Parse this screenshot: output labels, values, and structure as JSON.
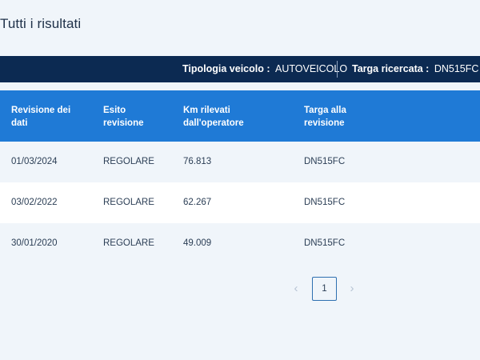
{
  "page_title": "Tutti i risultati",
  "info_bar": {
    "vehicle_type_label": "Tipologia veicolo :",
    "vehicle_type_value": "AUTOVEICOLO",
    "plate_label": "Targa ricercata :",
    "plate_value": "DN515FC"
  },
  "table": {
    "columns": [
      {
        "line1": "Revisione dei",
        "line2": "dati"
      },
      {
        "line1": "Esito",
        "line2": "revisione"
      },
      {
        "line1": "Km rilevati",
        "line2": "dall'operatore"
      },
      {
        "line1": "Targa alla",
        "line2": "revisione"
      }
    ],
    "rows": [
      {
        "date": "01/03/2024",
        "outcome": "REGOLARE",
        "km": "76.813",
        "plate": "DN515FC"
      },
      {
        "date": "03/02/2022",
        "outcome": "REGOLARE",
        "km": "62.267",
        "plate": "DN515FC"
      },
      {
        "date": "30/01/2020",
        "outcome": "REGOLARE",
        "km": "49.009",
        "plate": "DN515FC"
      }
    ]
  },
  "pagination": {
    "prev_icon": "chevron-left-icon",
    "current_page": "1",
    "next_icon": "chevron-right-icon",
    "prev_glyph": "‹",
    "next_glyph": "›"
  }
}
